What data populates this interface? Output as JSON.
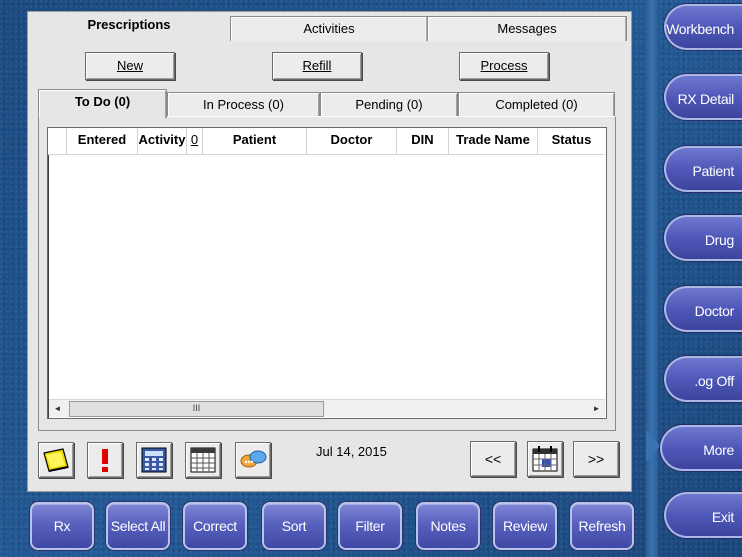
{
  "top_tabs": [
    "Prescriptions",
    "Activities",
    "Messages"
  ],
  "actions": {
    "new": "New",
    "refill": "Refill",
    "process": "Process"
  },
  "sub_tabs": [
    "To Do (0)",
    "In Process (0)",
    "Pending (0)",
    "Completed (0)"
  ],
  "columns": [
    "Entered",
    "Activity",
    "0",
    "Patient",
    "Doctor",
    "DIN",
    "Trade Name",
    "Status"
  ],
  "scroll": {
    "left": "◄",
    "right": "►",
    "grip": "III"
  },
  "toolbar": {
    "icons": [
      "sticky-note-icon",
      "alert-icon",
      "calculator-icon",
      "calendar-grid-icon",
      "chat-icon"
    ],
    "date": "Jul 14, 2015",
    "prev": "<<",
    "next": ">>"
  },
  "bottom_buttons": [
    "Rx",
    "Select All",
    "Correct",
    "Sort",
    "Filter",
    "Notes",
    "Review",
    "Refresh"
  ],
  "side_buttons": [
    "Workbench",
    "RX Detail",
    "Patient",
    "Drug",
    "Doctor",
    ".og Off",
    "More",
    "Exit"
  ],
  "colors": {
    "background": "#1f4f86",
    "button": "#5961be",
    "panel": "#e6e6e6"
  }
}
